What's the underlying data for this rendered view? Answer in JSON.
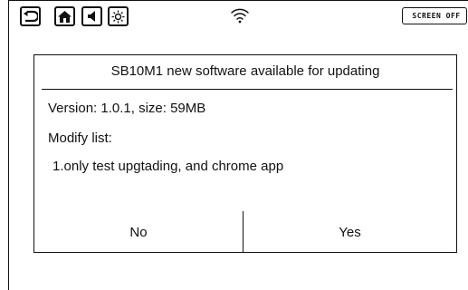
{
  "statusbar": {
    "buttons": [
      {
        "icon": "back-icon"
      },
      {
        "icon": "home-icon"
      },
      {
        "icon": "volume-icon"
      },
      {
        "icon": "brightness-icon"
      }
    ],
    "wifi_icon": "wifi-icon",
    "screen_off_label": "SCREEN OFF"
  },
  "dialog": {
    "title": "SB10M1 new software available for updating",
    "version_line": "Version: 1.0.1, size: 59MB",
    "modify_label": "Modify list:",
    "modify_items": [
      "1.only test upgtading, and chrome app"
    ],
    "no_label": "No",
    "yes_label": "Yes"
  }
}
